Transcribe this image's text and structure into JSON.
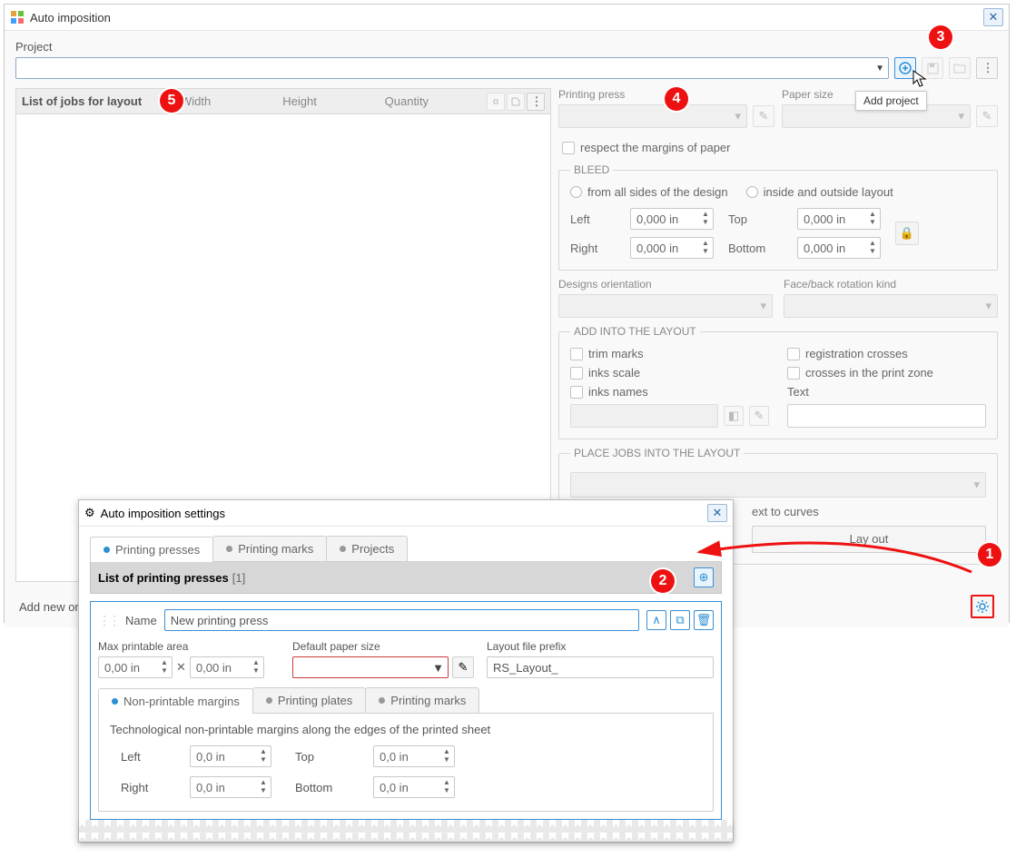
{
  "main": {
    "title": "Auto imposition",
    "project_label": "Project",
    "addproject_tip": "Add project",
    "status": "Add new or s"
  },
  "jobs": {
    "header": "List of jobs for layout",
    "col_width": "Width",
    "col_height": "Height",
    "col_quantity": "Quantity"
  },
  "right": {
    "printing_press": "Printing press",
    "paper_size": "Paper size",
    "respect_margins": "respect the margins of paper",
    "bleed_legend": "BLEED",
    "bleed_allsides": "from all sides of the design",
    "bleed_inout": "inside and outside layout",
    "left": "Left",
    "right_l": "Right",
    "top": "Top",
    "bottom": "Bottom",
    "bleed_val": "0,000 in",
    "designs_orient": "Designs orientation",
    "faceback": "Face/back rotation kind",
    "addinto_legend": "ADD INTO THE LAYOUT",
    "trim_marks": "trim marks",
    "inks_scale": "inks scale",
    "inks_names": "inks names",
    "reg_crosses": "registration crosses",
    "crosses_zone": "crosses in the print zone",
    "text_label": "Text",
    "place_legend": "PLACE JOBS INTO THE LAYOUT",
    "text_to_curves": "ext to curves",
    "layout_btn": "Lay out"
  },
  "settings": {
    "title": "Auto imposition settings",
    "tab_presses": "Printing presses",
    "tab_marks": "Printing marks",
    "tab_projects": "Projects",
    "list_header": "List of printing presses",
    "list_count": "[1]",
    "name_label": "Name",
    "name_value": "New printing press",
    "max_area": "Max printable area",
    "max_w": "0,00 in",
    "max_h": "0,00 in",
    "default_paper": "Default paper size",
    "prefix_label": "Layout file prefix",
    "prefix_value": "RS_Layout_",
    "subtab_margins": "Non-printable margins",
    "subtab_plates": "Printing plates",
    "subtab_pmarks": "Printing marks",
    "margins_desc": "Technological non-printable margins along the edges of the printed sheet",
    "m_left": "Left",
    "m_right": "Right",
    "m_top": "Top",
    "m_bottom": "Bottom",
    "m_val": "0,0 in"
  },
  "badges": {
    "b1": "1",
    "b2": "2",
    "b3": "3",
    "b4": "4",
    "b5": "5"
  }
}
